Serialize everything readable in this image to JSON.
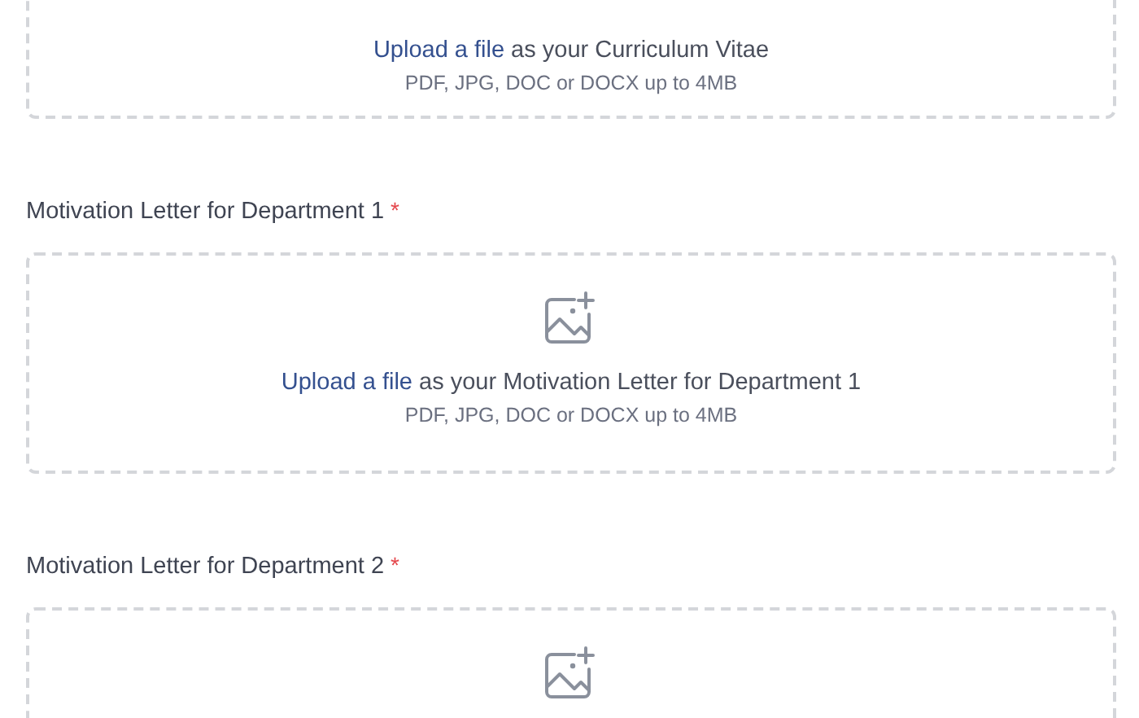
{
  "uploads": [
    {
      "icon": false,
      "link": "Upload a file",
      "text": "as your Curriculum Vitae",
      "hint": "PDF, JPG, DOC or DOCX up to 4MB"
    },
    {
      "label": "Motivation Letter for Department 1",
      "required": "*",
      "icon": true,
      "link": "Upload a file",
      "text": "as your Motivation Letter for Department 1",
      "hint": "PDF, JPG, DOC or DOCX up to 4MB"
    },
    {
      "label": "Motivation Letter for Department 2",
      "required": "*",
      "icon": true
    }
  ]
}
